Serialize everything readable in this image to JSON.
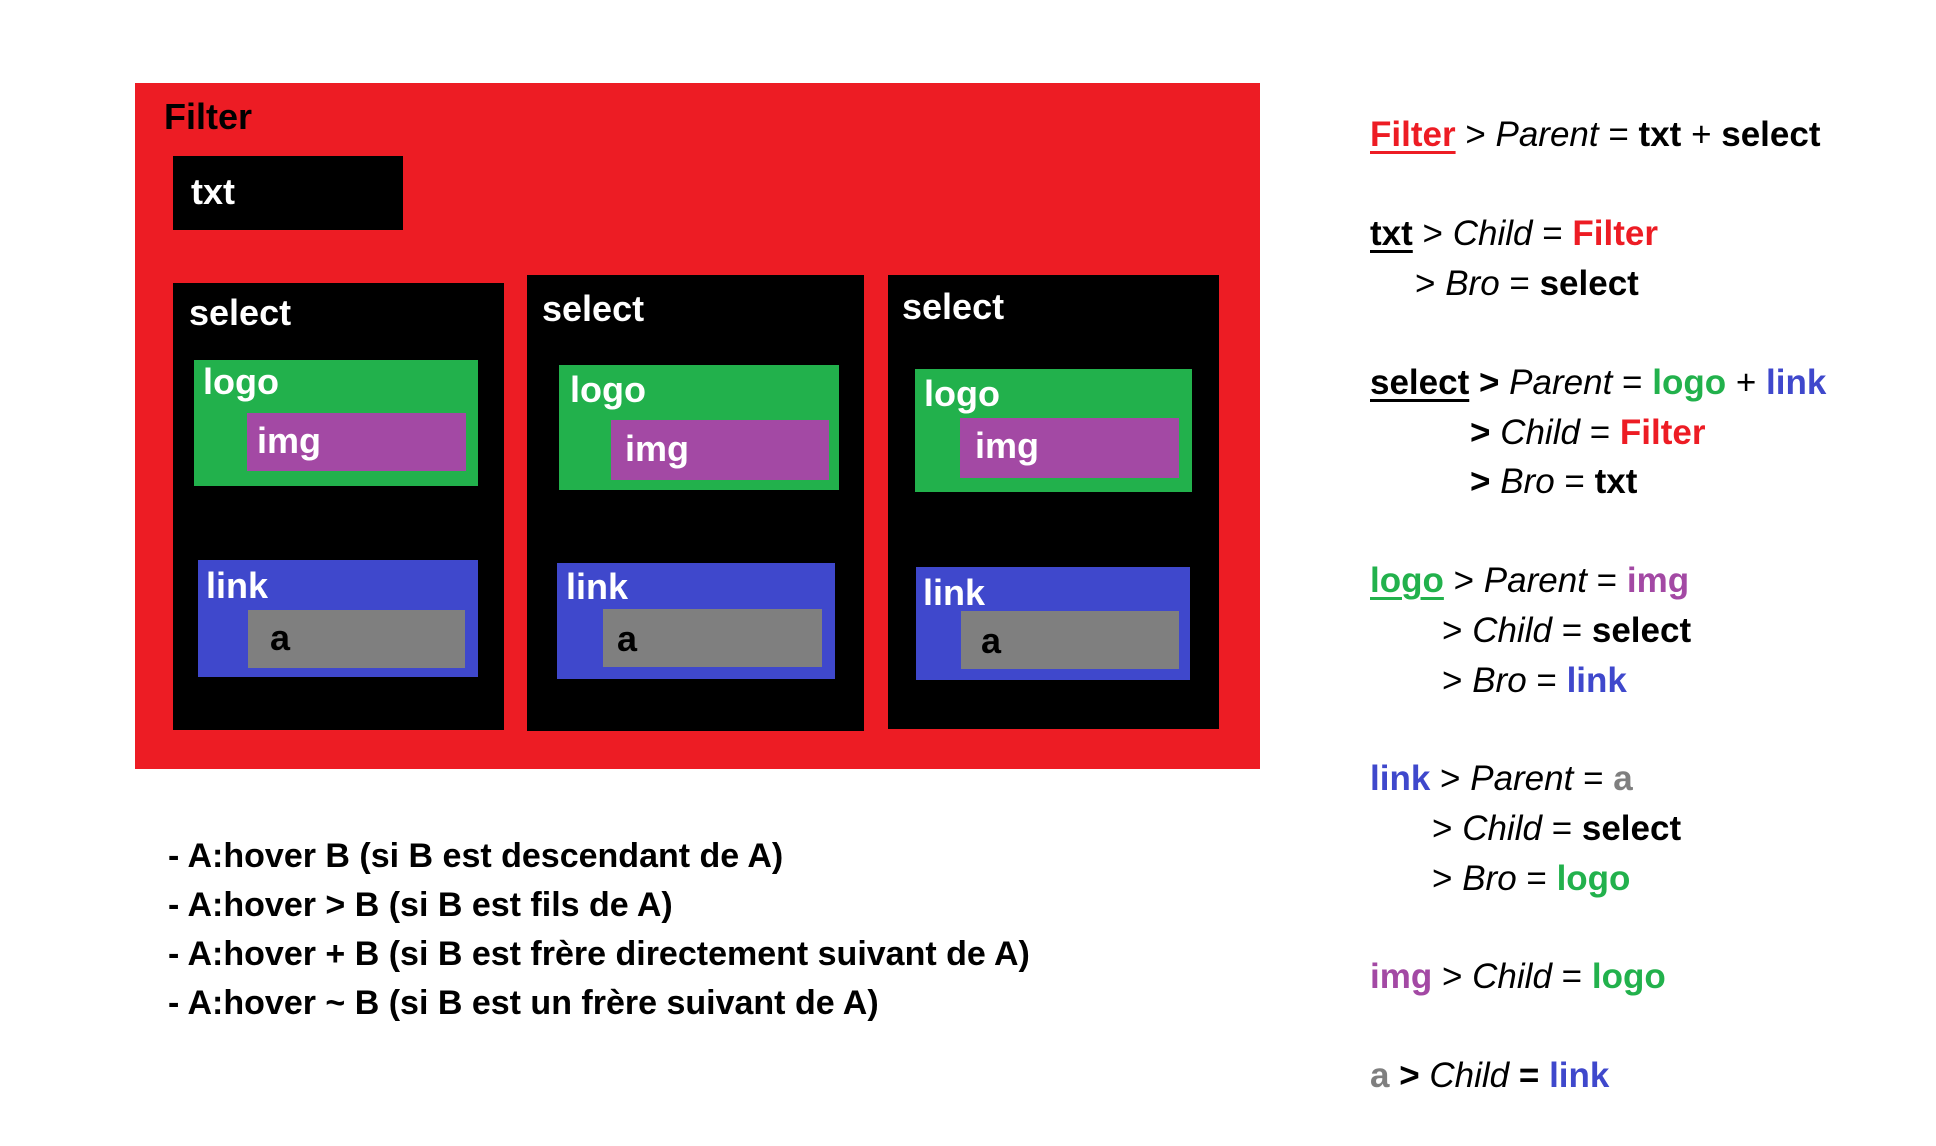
{
  "colors": {
    "filter": "#ed1c24",
    "box": "#000000",
    "logo": "#22b14c",
    "img": "#a349a4",
    "link": "#3f48cc",
    "a": "#7f7f7f"
  },
  "diagram": {
    "filter_label": "Filter",
    "txt_label": "txt",
    "selects": [
      {
        "label": "select",
        "logo_label": "logo",
        "img_label": "img",
        "link_label": "link",
        "a_label": "a"
      },
      {
        "label": "select",
        "logo_label": "logo",
        "img_label": "img",
        "link_label": "link",
        "a_label": "a"
      },
      {
        "label": "select",
        "logo_label": "logo",
        "img_label": "img",
        "link_label": "link",
        "a_label": "a"
      }
    ]
  },
  "rules": [
    "- A:hover B (si B est descendant de A)",
    "- A:hover > B (si B est fils de A)",
    "- A:hover + B (si B est frère directement suivant de A)",
    "- A:hover ~ B (si B est un frère suivant de A)"
  ],
  "legend": {
    "filter": {
      "name": "Filter",
      "sep": ">",
      "parent_word": "Parent",
      "eq": "=",
      "parent_a": "txt",
      "plus": "+",
      "parent_b": "select"
    },
    "txt": {
      "name": "txt",
      "sep": ">",
      "child_word": "Child",
      "eq": "=",
      "child": "Filter",
      "bro_word": "Bro",
      "bro": "select"
    },
    "select": {
      "name": "select",
      "sep": ">",
      "parent_word": "Parent",
      "eq": "=",
      "parent_a": "logo",
      "plus": "+",
      "parent_b": "link",
      "child_word": "Child",
      "child": "Filter",
      "bro_word": "Bro",
      "bro": "txt"
    },
    "logo": {
      "name": "logo",
      "sep": ">",
      "parent_word": "Parent",
      "eq": "=",
      "parent": "img",
      "child_word": "Child",
      "child": "select",
      "bro_word": "Bro",
      "bro": "link"
    },
    "link": {
      "name": "link",
      "sep": ">",
      "parent_word": "Parent",
      "eq": "=",
      "parent": "a",
      "child_word": "Child",
      "child": "select",
      "bro_word": "Bro",
      "bro": "logo"
    },
    "img": {
      "name": "img",
      "sep": ">",
      "child_word": "Child",
      "eq": "=",
      "child": "logo"
    },
    "a": {
      "name": "a",
      "sep": ">",
      "child_word": "Child",
      "eq": "=",
      "child": "link"
    }
  }
}
